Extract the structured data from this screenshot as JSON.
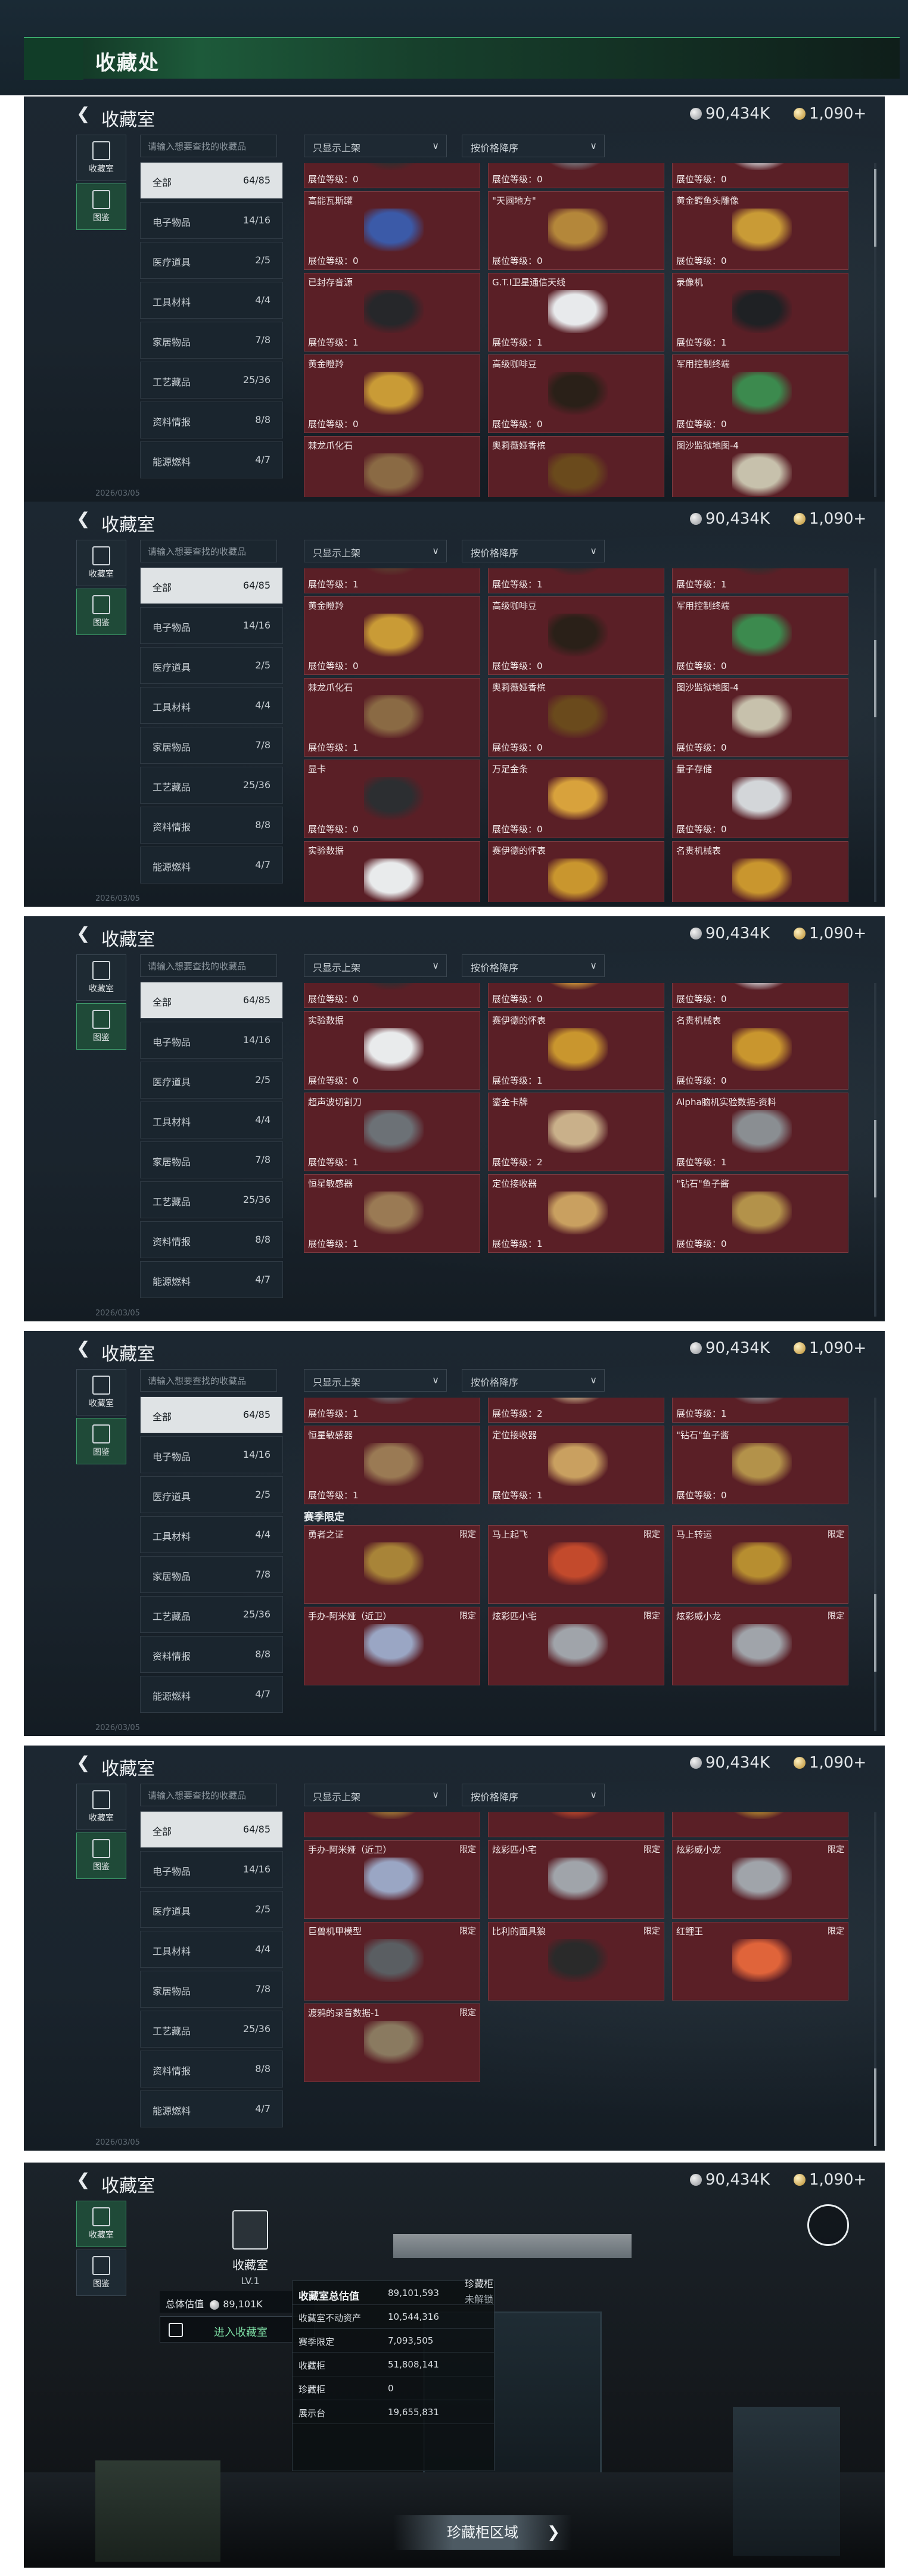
{
  "page_title": "收藏处",
  "header": {
    "title": "收藏室",
    "coins": "90,434K",
    "gems": "1,090+"
  },
  "side_tabs": [
    {
      "label": "收藏室",
      "icon": "trophy-icon"
    },
    {
      "label": "图鉴",
      "icon": "book-icon"
    }
  ],
  "search_placeholder": "请输入想要查找的收藏品",
  "filter": {
    "shelf_only": "只显示上架",
    "sort": "按价格降序"
  },
  "categories": [
    {
      "name": "全部",
      "count": "64/85"
    },
    {
      "name": "电子物品",
      "count": "14/16"
    },
    {
      "name": "医疗道具",
      "count": "2/5"
    },
    {
      "name": "工具材料",
      "count": "4/4"
    },
    {
      "name": "家居物品",
      "count": "7/8"
    },
    {
      "name": "工艺藏品",
      "count": "25/36"
    },
    {
      "name": "资料情报",
      "count": "8/8"
    },
    {
      "name": "能源燃料",
      "count": "4/7"
    }
  ],
  "footer_text": "2026/03/05",
  "panels": [
    {
      "cards": [
        {
          "name": "",
          "level": "展位等级：0",
          "color": "#2e2e2e",
          "limited": ""
        },
        {
          "name": "",
          "level": "展位等级：0",
          "color": "#7a7f84",
          "limited": ""
        },
        {
          "name": "",
          "level": "展位等级：0",
          "color": "#d6d9dc",
          "limited": ""
        },
        {
          "name": "高能瓦斯罐",
          "level": "展位等级：0",
          "color": "#3b5aa8",
          "limited": ""
        },
        {
          "name": "\"天圆地方\"",
          "level": "展位等级：0",
          "color": "#b4873a",
          "limited": ""
        },
        {
          "name": "黄金鳄鱼头雕像",
          "level": "展位等级：0",
          "color": "#c99b36",
          "limited": ""
        },
        {
          "name": "已封存音源",
          "level": "展位等级：1",
          "color": "#26272a",
          "limited": ""
        },
        {
          "name": "G.T.I卫星通信天线",
          "level": "展位等级：1",
          "color": "#e8eaec",
          "limited": ""
        },
        {
          "name": "录像机",
          "level": "展位等级：1",
          "color": "#1f2124",
          "limited": ""
        },
        {
          "name": "黄金瞪羚",
          "level": "展位等级：0",
          "color": "#c99b36",
          "limited": ""
        },
        {
          "name": "高级咖啡豆",
          "level": "展位等级：0",
          "color": "#2a2018",
          "limited": ""
        },
        {
          "name": "军用控制终端",
          "level": "展位等级：0",
          "color": "#3c8a4e",
          "limited": ""
        },
        {
          "name": "棘龙爪化石",
          "level": "",
          "color": "#8a6a44",
          "limited": ""
        },
        {
          "name": "奥莉薇娅香槟",
          "level": "",
          "color": "#6a4a1c",
          "limited": ""
        },
        {
          "name": "图沙监狱地图-4",
          "level": "",
          "color": "#c7c1ac",
          "limited": ""
        }
      ]
    },
    {
      "cards": [
        {
          "name": "",
          "level": "展位等级：1",
          "color": "#5a4030",
          "limited": ""
        },
        {
          "name": "",
          "level": "展位等级：1",
          "color": "#2a2a2a",
          "limited": ""
        },
        {
          "name": "",
          "level": "展位等级：1",
          "color": "#2e2e2e",
          "limited": ""
        },
        {
          "name": "黄金瞪羚",
          "level": "展位等级：0",
          "color": "#c99b36",
          "limited": ""
        },
        {
          "name": "高级咖啡豆",
          "level": "展位等级：0",
          "color": "#2a2018",
          "limited": ""
        },
        {
          "name": "军用控制终端",
          "level": "展位等级：0",
          "color": "#3c8a4e",
          "limited": ""
        },
        {
          "name": "棘龙爪化石",
          "level": "展位等级：1",
          "color": "#8a6a44",
          "limited": ""
        },
        {
          "name": "奥莉薇娅香槟",
          "level": "展位等级：0",
          "color": "#6a4a1c",
          "limited": ""
        },
        {
          "name": "图沙监狱地图-4",
          "level": "展位等级：0",
          "color": "#c7c1ac",
          "limited": ""
        },
        {
          "name": "显卡",
          "level": "展位等级：0",
          "color": "#2c2e31",
          "limited": ""
        },
        {
          "name": "万足金条",
          "level": "展位等级：0",
          "color": "#d8a23c",
          "limited": ""
        },
        {
          "name": "量子存储",
          "level": "展位等级：0",
          "color": "#d3d6d9",
          "limited": ""
        },
        {
          "name": "实验数据",
          "level": "",
          "color": "#e9ebec",
          "limited": ""
        },
        {
          "name": "赛伊德的怀表",
          "level": "",
          "color": "#c9962e",
          "limited": ""
        },
        {
          "name": "名贵机械表",
          "level": "",
          "color": "#c9962e",
          "limited": ""
        }
      ]
    },
    {
      "cards": [
        {
          "name": "显卡",
          "level": "展位等级：0",
          "color": "#2c2e31",
          "limited": ""
        },
        {
          "name": "万足金条",
          "level": "展位等级：0",
          "color": "#d8a23c",
          "limited": ""
        },
        {
          "name": "量子存储",
          "level": "展位等级：0",
          "color": "#d3d6d9",
          "limited": ""
        },
        {
          "name": "实验数据",
          "level": "展位等级：0",
          "color": "#e9ebec",
          "limited": ""
        },
        {
          "name": "赛伊德的怀表",
          "level": "展位等级：1",
          "color": "#c9962e",
          "limited": ""
        },
        {
          "name": "名贵机械表",
          "level": "展位等级：0",
          "color": "#c9962e",
          "limited": ""
        },
        {
          "name": "超声波切割刀",
          "level": "展位等级：1",
          "color": "#6c7176",
          "limited": ""
        },
        {
          "name": "鎏金卡牌",
          "level": "展位等级：2",
          "color": "#c9b08a",
          "limited": ""
        },
        {
          "name": "Alpha脑机实验数据-资料",
          "level": "展位等级：1",
          "color": "#8a8e92",
          "limited": ""
        },
        {
          "name": "恒星敏感器",
          "level": "展位等级：1",
          "color": "#9a7a54",
          "limited": ""
        },
        {
          "name": "定位接收器",
          "level": "展位等级：1",
          "color": "#c9a060",
          "limited": ""
        },
        {
          "name": "\"钻石\"鱼子酱",
          "level": "展位等级：0",
          "color": "#b3924a",
          "limited": ""
        }
      ]
    },
    {
      "cards": [
        {
          "name": "",
          "level": "展位等级：1",
          "color": "#6c7176",
          "limited": ""
        },
        {
          "name": "",
          "level": "展位等级：2",
          "color": "#c9b08a",
          "limited": ""
        },
        {
          "name": "",
          "level": "展位等级：1",
          "color": "#8a8e92",
          "limited": ""
        },
        {
          "name": "恒星敏感器",
          "level": "展位等级：1",
          "color": "#9a7a54",
          "limited": ""
        },
        {
          "name": "定位接收器",
          "level": "展位等级：1",
          "color": "#c9a060",
          "limited": ""
        },
        {
          "name": "\"钻石\"鱼子酱",
          "level": "展位等级：0",
          "color": "#b3924a",
          "limited": ""
        }
      ],
      "section_title": "赛季限定",
      "limited_cards": [
        {
          "name": "勇者之证",
          "level": "",
          "color": "#a88438",
          "limited": "限定"
        },
        {
          "name": "马上起飞",
          "level": "",
          "color": "#c34a2c",
          "limited": "限定"
        },
        {
          "name": "马上转运",
          "level": "",
          "color": "#b78e30",
          "limited": "限定"
        },
        {
          "name": "手办-阿米娅（近卫）",
          "level": "",
          "color": "#9aa6c4",
          "limited": "限定"
        },
        {
          "name": "炫彩匹小宅",
          "level": "",
          "color": "#a0a4aa",
          "limited": "限定"
        },
        {
          "name": "炫彩威小龙",
          "level": "",
          "color": "#a0a4aa",
          "limited": "限定"
        }
      ]
    },
    {
      "cards": [
        {
          "name": "勇者之证",
          "level": "",
          "color": "#a88438",
          "limited": "限定"
        },
        {
          "name": "马上起飞",
          "level": "",
          "color": "#c34a2c",
          "limited": "限定"
        },
        {
          "name": "马上转运",
          "level": "",
          "color": "#b78e30",
          "limited": "限定"
        },
        {
          "name": "手办-阿米娅（近卫）",
          "level": "",
          "color": "#9aa6c4",
          "limited": "限定"
        },
        {
          "name": "炫彩匹小宅",
          "level": "",
          "color": "#a0a4aa",
          "limited": "限定"
        },
        {
          "name": "炫彩威小龙",
          "level": "",
          "color": "#a0a4aa",
          "limited": "限定"
        },
        {
          "name": "巨兽机甲模型",
          "level": "",
          "color": "#5a5e62",
          "limited": "限定"
        },
        {
          "name": "比利的面具狼",
          "level": "",
          "color": "#2a2a2a",
          "limited": "限定"
        },
        {
          "name": "红鲤王",
          "level": "",
          "color": "#e0643a",
          "limited": "限定"
        },
        {
          "name": "渡鸦的录音数据-1",
          "level": "",
          "color": "#8a7a60",
          "limited": "限定"
        }
      ]
    }
  ],
  "lobby": {
    "title": "收藏室",
    "level": "LV.1",
    "valuation_label": "总体估值",
    "valuation_value": "89,101K",
    "enter_label": "进入收藏室",
    "cabinet_title": "珍藏柜",
    "cabinet_status": "未解锁",
    "zone_button": "珍藏柜区域",
    "stats": [
      {
        "k": "收藏室总估值",
        "v": "89,101,593"
      },
      {
        "k": "收藏室不动资产",
        "v": "10,544,316"
      },
      {
        "k": "赛季限定",
        "v": "7,093,505"
      },
      {
        "k": "收藏柜",
        "v": "51,808,141"
      },
      {
        "k": "珍藏柜",
        "v": "0"
      },
      {
        "k": "展示台",
        "v": "19,655,831"
      }
    ]
  }
}
